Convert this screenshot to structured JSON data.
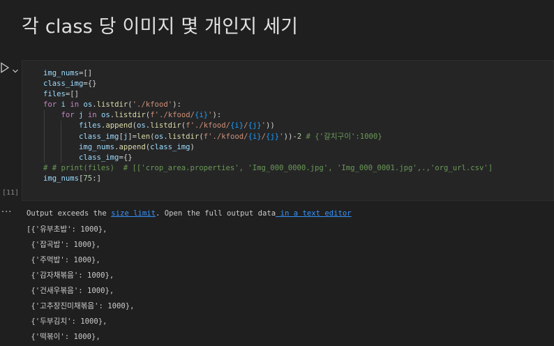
{
  "markdown": {
    "heading": "각 class 당 이미지 몇 개인지 세기"
  },
  "cell": {
    "execution_count": "[11]",
    "code_lines": [
      [
        [
          "var",
          "img_nums"
        ],
        [
          "pun",
          "="
        ],
        [
          "pun",
          "[]"
        ]
      ],
      [
        [
          "var",
          "class_img"
        ],
        [
          "pun",
          "="
        ],
        [
          "pun",
          "{}"
        ]
      ],
      [
        [
          "var",
          "files"
        ],
        [
          "pun",
          "="
        ],
        [
          "pun",
          "[]"
        ]
      ],
      [
        [
          "kw",
          "for"
        ],
        [
          "pun",
          " "
        ],
        [
          "var",
          "i"
        ],
        [
          "pun",
          " "
        ],
        [
          "kw",
          "in"
        ],
        [
          "pun",
          " "
        ],
        [
          "var",
          "os"
        ],
        [
          "pun",
          "."
        ],
        [
          "fn",
          "listdir"
        ],
        [
          "pun",
          "("
        ],
        [
          "str",
          "'./kfood'"
        ],
        [
          "pun",
          "):"
        ]
      ],
      [
        [
          "pun",
          "    "
        ],
        [
          "kw",
          "for"
        ],
        [
          "pun",
          " "
        ],
        [
          "var",
          "j"
        ],
        [
          "pun",
          " "
        ],
        [
          "kw",
          "in"
        ],
        [
          "pun",
          " "
        ],
        [
          "var",
          "os"
        ],
        [
          "pun",
          "."
        ],
        [
          "fn",
          "listdir"
        ],
        [
          "pun",
          "("
        ],
        [
          "str",
          "f'./kfood/"
        ],
        [
          "brk2",
          "{i}"
        ],
        [
          "str",
          "'"
        ],
        [
          "pun",
          "):"
        ]
      ],
      [
        [
          "pun",
          "        "
        ],
        [
          "var",
          "files"
        ],
        [
          "pun",
          "."
        ],
        [
          "fn",
          "append"
        ],
        [
          "pun",
          "("
        ],
        [
          "var",
          "os"
        ],
        [
          "pun",
          "."
        ],
        [
          "fn",
          "listdir"
        ],
        [
          "pun",
          "("
        ],
        [
          "str",
          "f'./kfood/"
        ],
        [
          "brk2",
          "{i}"
        ],
        [
          "str",
          "/"
        ],
        [
          "brk2",
          "{j}"
        ],
        [
          "str",
          "'"
        ],
        [
          "pun",
          "))"
        ]
      ],
      [
        [
          "pun",
          "        "
        ],
        [
          "var",
          "class_img"
        ],
        [
          "pun",
          "["
        ],
        [
          "var",
          "j"
        ],
        [
          "pun",
          "]="
        ],
        [
          "fn",
          "len"
        ],
        [
          "pun",
          "("
        ],
        [
          "var",
          "os"
        ],
        [
          "pun",
          "."
        ],
        [
          "fn",
          "listdir"
        ],
        [
          "pun",
          "("
        ],
        [
          "str",
          "f'./kfood/"
        ],
        [
          "brk2",
          "{i}"
        ],
        [
          "str",
          "/"
        ],
        [
          "brk2",
          "{j}"
        ],
        [
          "str",
          "'"
        ],
        [
          "pun",
          "))-"
        ],
        [
          "num",
          "2"
        ],
        [
          "pun",
          " "
        ],
        [
          "cmt",
          "# {'갈치구이':1000}"
        ]
      ],
      [
        [
          "pun",
          "        "
        ],
        [
          "var",
          "img_nums"
        ],
        [
          "pun",
          "."
        ],
        [
          "fn",
          "append"
        ],
        [
          "pun",
          "("
        ],
        [
          "var",
          "class_img"
        ],
        [
          "pun",
          ")"
        ]
      ],
      [
        [
          "pun",
          "        "
        ],
        [
          "var",
          "class_img"
        ],
        [
          "pun",
          "="
        ],
        [
          "pun",
          "{}"
        ]
      ],
      [
        [
          "cmt",
          "# # print(files)  # [['crop_area.properties', 'Img_000_0000.jpg', 'Img_000_0001.jpg',.,'org_url.csv']"
        ]
      ],
      [
        [
          "var",
          "img_nums"
        ],
        [
          "pun",
          "["
        ],
        [
          "num",
          "75"
        ],
        [
          "pun",
          ":]"
        ]
      ]
    ]
  },
  "output": {
    "notice_prefix": "Output exceeds the ",
    "size_limit_link": "size limit",
    "notice_middle": ". Open the full output data",
    "text_editor_link": " in a text editor",
    "lines": [
      "[{'유부초밥': 1000},",
      " {'잡곡밥': 1000},",
      " {'주먹밥': 1000},",
      " {'감자채볶음': 1000},",
      " {'건새우볶음': 1000},",
      " {'고추장진미채볶음': 1000},",
      " {'두부김치': 1000},",
      " {'떡볶이': 1000},"
    ]
  },
  "icons": {
    "run": "play-icon",
    "chevron": "chevron-down-icon",
    "more": "ellipsis-icon"
  }
}
